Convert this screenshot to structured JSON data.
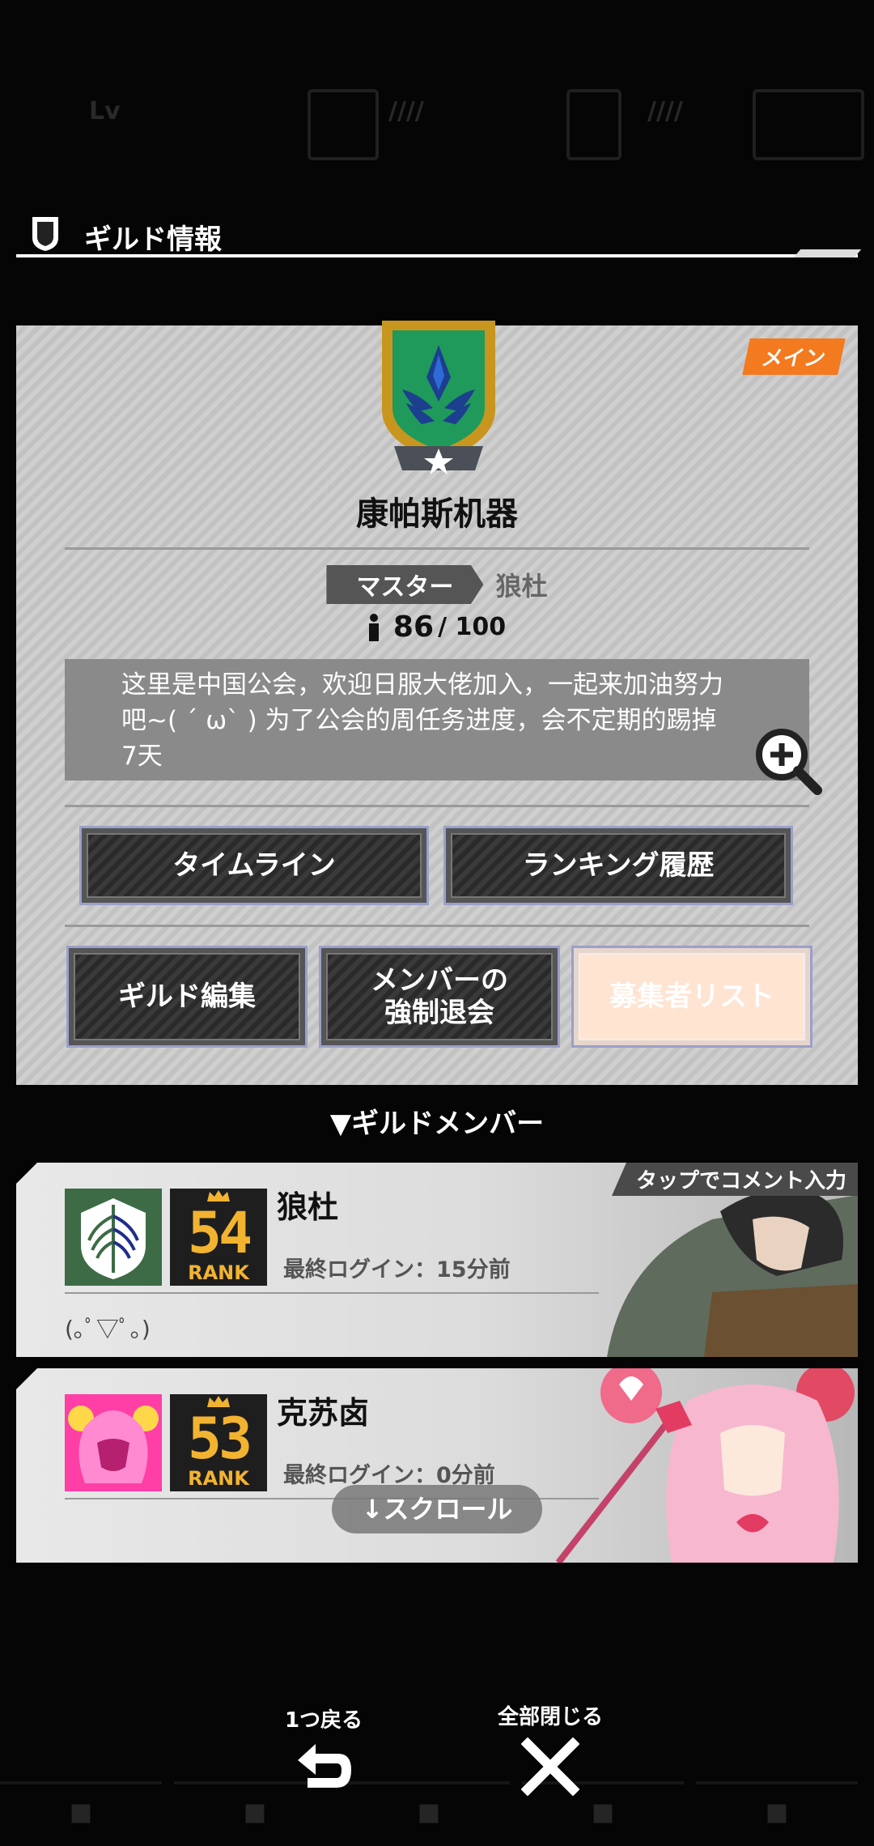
{
  "header": {
    "title": "ギルド情報"
  },
  "guild": {
    "tag": "メイン",
    "name": "康帕斯机器",
    "master_label": "マスター",
    "master_name": "狼杜",
    "member_count": "86",
    "member_max": "/ 100",
    "description": "这里是中国公会，欢迎日服大佬加入，一起来加油努力吧~(  ´ ω` ) 为了公会的周任务进度，会不定期的踢掉7天"
  },
  "buttons": {
    "timeline": "タイムライン",
    "ranking_history": "ランキング履歴",
    "guild_edit": "ギルド編集",
    "force_leave_line1": "メンバーの",
    "force_leave_line2": "強制退会",
    "recruit_list": "募集者リスト"
  },
  "members_section": {
    "title": "▼ギルドメンバー"
  },
  "members": [
    {
      "name": "狼杜",
      "rank": "54",
      "rank_label": "RANK",
      "last_login": "最終ログイン：15分前",
      "comment": "(｡ﾟ▽ﾟ｡)",
      "tap_hint": "タップでコメント入力"
    },
    {
      "name": "克苏卤",
      "rank": "53",
      "rank_label": "RANK",
      "last_login": "最終ログイン：0分前"
    }
  ],
  "scroll_hint": "↓スクロール",
  "bottom": {
    "back_label": "1つ戻る",
    "close_all_label": "全部閉じる"
  },
  "colors": {
    "accent_orange": "#f37a1f",
    "rank_gold": "#f2b330",
    "emblem_green": "#1f9a5a",
    "emblem_gold": "#c8961e"
  },
  "icons": [
    "shield-icon",
    "guild-emblem",
    "person-icon",
    "zoom-in-icon",
    "scout-regiment-icon",
    "pink-hair-icon",
    "back-arrow-icon",
    "close-icon"
  ]
}
